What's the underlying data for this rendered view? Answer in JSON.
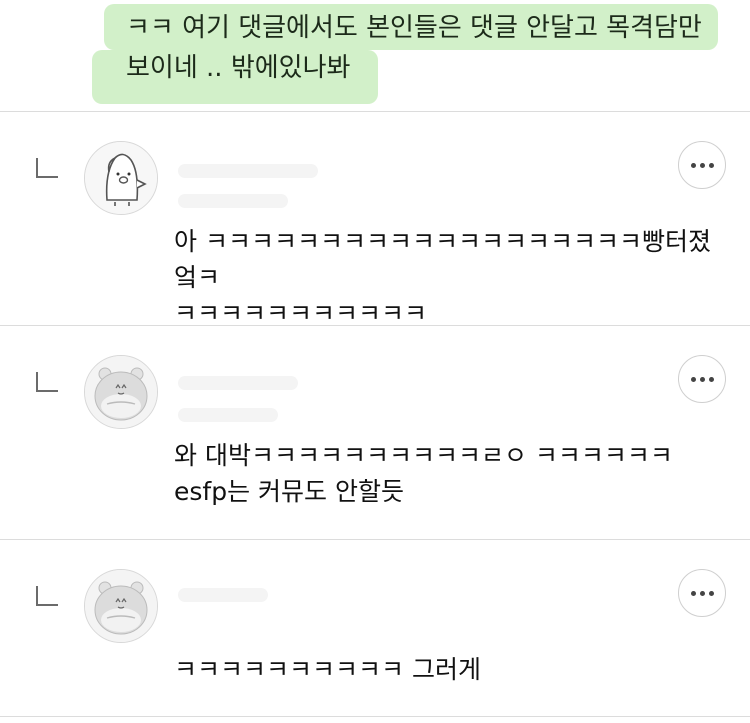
{
  "top_comment": {
    "text": "ㅋㅋ 여기 댓글에서도 본인들은 댓글 안달고 목격담만\n보이네 .. 밖에있나봐"
  },
  "replies": [
    {
      "text": "아 ㅋㅋㅋㅋㅋㅋㅋㅋㅋㅋㅋㅋㅋㅋㅋㅋㅋㅋㅋ빵터졌엌ㅋ\nㅋㅋㅋㅋㅋㅋㅋㅋㅋㅋㅋ",
      "avatar_icon": "penguin-pig-avatar-icon",
      "more_icon": "more-options-icon"
    },
    {
      "text": "와 대박ㅋㅋㅋㅋㅋㅋㅋㅋㅋㅋㄹㅇ ㅋㅋㅋㅋㅋㅋ\nesfp는 커뮤도 안할듯",
      "avatar_icon": "hamster-avatar-icon",
      "more_icon": "more-options-icon"
    },
    {
      "text": "ㅋㅋㅋㅋㅋㅋㅋㅋㅋㅋ 그러게",
      "avatar_icon": "hamster-avatar-icon",
      "more_icon": "more-options-icon"
    }
  ],
  "colors": {
    "highlight": "#cdeec3",
    "divider": "#dcdcdc",
    "text": "#111111"
  }
}
